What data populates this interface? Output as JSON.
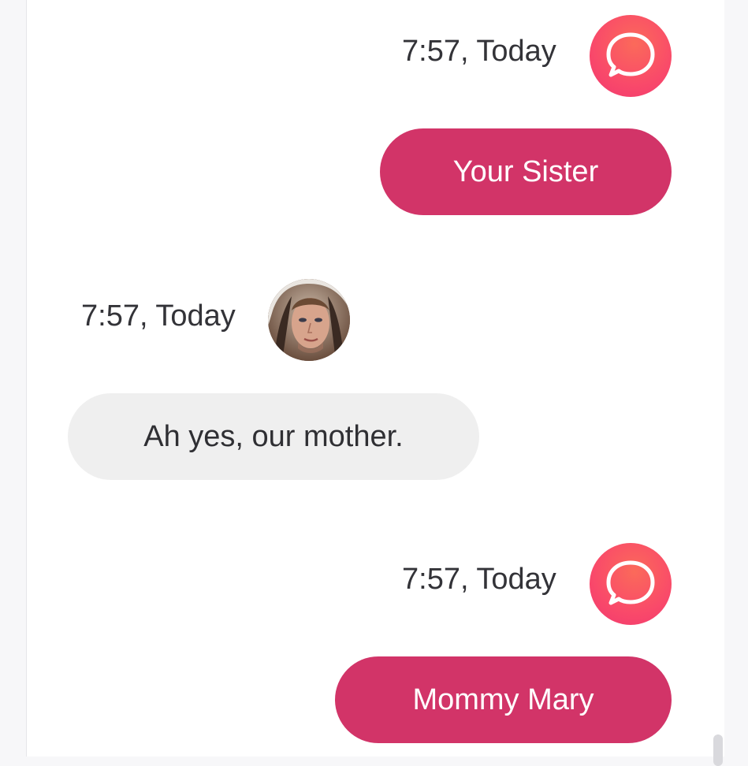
{
  "colors": {
    "outgoing_bubble": "#d23468",
    "incoming_bubble": "#efefef",
    "app_avatar": "#f9496a",
    "background": "#ffffff"
  },
  "messages": [
    {
      "direction": "outgoing",
      "timestamp": "7:57, Today",
      "avatar_icon": "speech-bubble-icon",
      "text": "Your Sister"
    },
    {
      "direction": "incoming",
      "timestamp": "7:57, Today",
      "avatar_icon": "user-photo",
      "text": "Ah yes, our mother."
    },
    {
      "direction": "outgoing",
      "timestamp": "7:57, Today",
      "avatar_icon": "speech-bubble-icon",
      "text": "Mommy Mary"
    }
  ]
}
